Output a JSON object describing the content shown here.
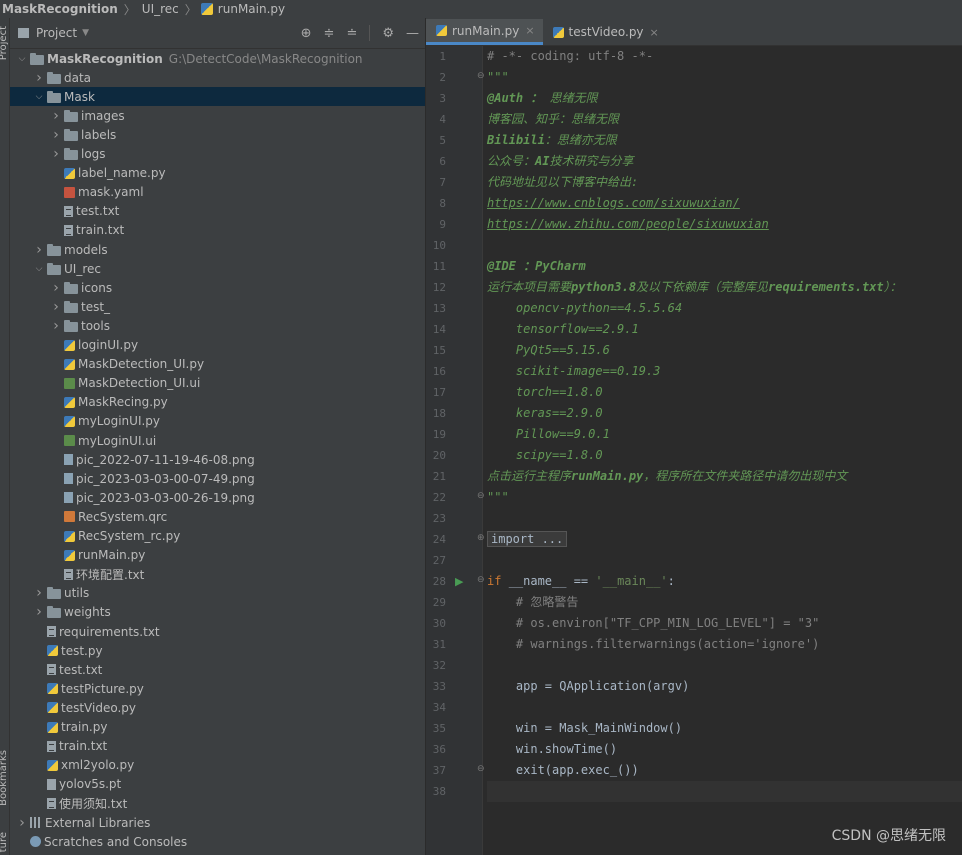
{
  "breadcrumb": {
    "items": [
      "MaskRecognition",
      "UI_rec",
      "runMain.py"
    ]
  },
  "side_labels": {
    "project": "Project",
    "bookmarks": "Bookmarks",
    "structure": "ture"
  },
  "project_panel": {
    "title": "Project",
    "tools": [
      "⊕",
      "≑",
      "≐",
      "⚙",
      "—"
    ]
  },
  "tree": [
    {
      "label": "MaskRecognition",
      "path": "G:\\DetectCode\\MaskRecognition",
      "depth": 0,
      "icon": "folder",
      "expanded": true,
      "bold": true
    },
    {
      "label": "data",
      "depth": 1,
      "icon": "folder",
      "expanded": false
    },
    {
      "label": "Mask",
      "depth": 1,
      "icon": "folder",
      "expanded": true,
      "selected": true
    },
    {
      "label": "images",
      "depth": 2,
      "icon": "folder",
      "expanded": false
    },
    {
      "label": "labels",
      "depth": 2,
      "icon": "folder",
      "expanded": false
    },
    {
      "label": "logs",
      "depth": 2,
      "icon": "folder",
      "expanded": false
    },
    {
      "label": "label_name.py",
      "depth": 2,
      "icon": "py"
    },
    {
      "label": "mask.yaml",
      "depth": 2,
      "icon": "yaml"
    },
    {
      "label": "test.txt",
      "depth": 2,
      "icon": "txt"
    },
    {
      "label": "train.txt",
      "depth": 2,
      "icon": "txt"
    },
    {
      "label": "models",
      "depth": 1,
      "icon": "folder",
      "expanded": false
    },
    {
      "label": "UI_rec",
      "depth": 1,
      "icon": "folder",
      "expanded": true
    },
    {
      "label": "icons",
      "depth": 2,
      "icon": "folder",
      "expanded": false
    },
    {
      "label": "test_",
      "depth": 2,
      "icon": "folder",
      "expanded": false
    },
    {
      "label": "tools",
      "depth": 2,
      "icon": "folder",
      "expanded": false
    },
    {
      "label": "loginUI.py",
      "depth": 2,
      "icon": "py"
    },
    {
      "label": "MaskDetection_UI.py",
      "depth": 2,
      "icon": "py"
    },
    {
      "label": "MaskDetection_UI.ui",
      "depth": 2,
      "icon": "ui"
    },
    {
      "label": "MaskRecing.py",
      "depth": 2,
      "icon": "py"
    },
    {
      "label": "myLoginUI.py",
      "depth": 2,
      "icon": "py"
    },
    {
      "label": "myLoginUI.ui",
      "depth": 2,
      "icon": "ui"
    },
    {
      "label": "pic_2022-07-11-19-46-08.png",
      "depth": 2,
      "icon": "png"
    },
    {
      "label": "pic_2023-03-03-00-07-49.png",
      "depth": 2,
      "icon": "png"
    },
    {
      "label": "pic_2023-03-03-00-26-19.png",
      "depth": 2,
      "icon": "png"
    },
    {
      "label": "RecSystem.qrc",
      "depth": 2,
      "icon": "qrc"
    },
    {
      "label": "RecSystem_rc.py",
      "depth": 2,
      "icon": "py"
    },
    {
      "label": "runMain.py",
      "depth": 2,
      "icon": "py"
    },
    {
      "label": "环境配置.txt",
      "depth": 2,
      "icon": "txt"
    },
    {
      "label": "utils",
      "depth": 1,
      "icon": "folder",
      "expanded": false
    },
    {
      "label": "weights",
      "depth": 1,
      "icon": "folder",
      "expanded": false
    },
    {
      "label": "requirements.txt",
      "depth": 1,
      "icon": "txt"
    },
    {
      "label": "test.py",
      "depth": 1,
      "icon": "py"
    },
    {
      "label": "test.txt",
      "depth": 1,
      "icon": "txt"
    },
    {
      "label": "testPicture.py",
      "depth": 1,
      "icon": "py"
    },
    {
      "label": "testVideo.py",
      "depth": 1,
      "icon": "py"
    },
    {
      "label": "train.py",
      "depth": 1,
      "icon": "py"
    },
    {
      "label": "train.txt",
      "depth": 1,
      "icon": "txt"
    },
    {
      "label": "xml2yolo.py",
      "depth": 1,
      "icon": "py"
    },
    {
      "label": "yolov5s.pt",
      "depth": 1,
      "icon": "pt"
    },
    {
      "label": "使用须知.txt",
      "depth": 1,
      "icon": "txt"
    },
    {
      "label": "External Libraries",
      "depth": 0,
      "icon": "lib",
      "expanded": false
    },
    {
      "label": "Scratches and Consoles",
      "depth": 0,
      "icon": "scratch"
    }
  ],
  "editor_tabs": [
    {
      "label": "runMain.py",
      "active": true,
      "close": "×"
    },
    {
      "label": "testVideo.py",
      "active": false,
      "close": "×"
    }
  ],
  "code_lines": [
    {
      "n": "1",
      "parts": [
        {
          "c": "cmt",
          "t": "# -*- coding: utf-8 -*-"
        }
      ]
    },
    {
      "n": "2",
      "fold": "⊖",
      "parts": [
        {
          "c": "doc",
          "t": "\"\"\""
        }
      ]
    },
    {
      "n": "3",
      "parts": [
        {
          "c": "docb",
          "t": "@Auth ： "
        },
        {
          "c": "doc",
          "t": "思绪无限"
        }
      ]
    },
    {
      "n": "4",
      "parts": [
        {
          "c": "doc",
          "t": "博客园、知乎：思绪无限"
        }
      ]
    },
    {
      "n": "5",
      "parts": [
        {
          "c": "docb",
          "t": "Bilibili"
        },
        {
          "c": "doc",
          "t": "：思绪亦无限"
        }
      ]
    },
    {
      "n": "6",
      "parts": [
        {
          "c": "doc",
          "t": "公众号："
        },
        {
          "c": "docb",
          "t": "AI"
        },
        {
          "c": "doc",
          "t": "技术研究与分享"
        }
      ]
    },
    {
      "n": "7",
      "parts": [
        {
          "c": "doc",
          "t": "代码地址见以下博客中给出:"
        }
      ]
    },
    {
      "n": "8",
      "parts": [
        {
          "c": "link",
          "t": "https://www.cnblogs.com/sixuwuxian/"
        }
      ]
    },
    {
      "n": "9",
      "parts": [
        {
          "c": "link",
          "t": "https://www.zhihu.com/people/sixuwuxian"
        }
      ]
    },
    {
      "n": "10",
      "parts": []
    },
    {
      "n": "11",
      "parts": [
        {
          "c": "docb",
          "t": "@IDE ：PyCharm"
        }
      ]
    },
    {
      "n": "12",
      "parts": [
        {
          "c": "doc",
          "t": "运行本项目需要"
        },
        {
          "c": "docb",
          "t": "python3.8"
        },
        {
          "c": "doc",
          "t": "及以下依赖库（完整库见"
        },
        {
          "c": "docb",
          "t": "requirements.txt"
        },
        {
          "c": "doc",
          "t": "）："
        }
      ]
    },
    {
      "n": "13",
      "parts": [
        {
          "c": "doc",
          "t": "    opencv-python==4.5.5.64"
        }
      ]
    },
    {
      "n": "14",
      "parts": [
        {
          "c": "doc",
          "t": "    tensorflow==2.9.1"
        }
      ]
    },
    {
      "n": "15",
      "parts": [
        {
          "c": "doc",
          "t": "    PyQt5==5.15.6"
        }
      ]
    },
    {
      "n": "16",
      "parts": [
        {
          "c": "doc",
          "t": "    scikit-image==0.19.3"
        }
      ]
    },
    {
      "n": "17",
      "parts": [
        {
          "c": "doc",
          "t": "    torch==1.8.0"
        }
      ]
    },
    {
      "n": "18",
      "parts": [
        {
          "c": "doc",
          "t": "    keras==2.9.0"
        }
      ]
    },
    {
      "n": "19",
      "parts": [
        {
          "c": "doc",
          "t": "    Pillow==9.0.1"
        }
      ]
    },
    {
      "n": "20",
      "parts": [
        {
          "c": "doc",
          "t": "    scipy==1.8.0"
        }
      ]
    },
    {
      "n": "21",
      "parts": [
        {
          "c": "doc",
          "t": "点击运行主程序"
        },
        {
          "c": "docb",
          "t": "runMain.py"
        },
        {
          "c": "doc",
          "t": "，程序所在文件夹路径中请勿出现中文"
        }
      ]
    },
    {
      "n": "22",
      "fold": "⊖",
      "parts": [
        {
          "c": "doc",
          "t": "\"\"\""
        }
      ]
    },
    {
      "n": "23",
      "parts": []
    },
    {
      "n": "24",
      "fold": "⊕",
      "parts": [
        {
          "c": "foldbox",
          "t": "import ..."
        }
      ]
    },
    {
      "n": "27",
      "parts": []
    },
    {
      "n": "28",
      "run": "▶",
      "fold": "⊖",
      "parts": [
        {
          "c": "kw",
          "t": "if "
        },
        {
          "c": "",
          "t": "__name__ == "
        },
        {
          "c": "str",
          "t": "'__main__'"
        },
        {
          "c": "",
          "t": ":"
        }
      ]
    },
    {
      "n": "29",
      "parts": [
        {
          "c": "cmt",
          "t": "    # 忽略警告"
        }
      ]
    },
    {
      "n": "30",
      "parts": [
        {
          "c": "cmt",
          "t": "    # os.environ[\"TF_CPP_MIN_LOG_LEVEL\"] = \"3\""
        }
      ]
    },
    {
      "n": "31",
      "parts": [
        {
          "c": "cmt",
          "t": "    # warnings.filterwarnings(action='ignore')"
        }
      ]
    },
    {
      "n": "32",
      "parts": []
    },
    {
      "n": "33",
      "parts": [
        {
          "c": "",
          "t": "    app = QApplication(argv)"
        }
      ]
    },
    {
      "n": "34",
      "parts": []
    },
    {
      "n": "35",
      "parts": [
        {
          "c": "",
          "t": "    win = Mask_MainWindow()"
        }
      ]
    },
    {
      "n": "36",
      "parts": [
        {
          "c": "",
          "t": "    win.showTime()"
        }
      ]
    },
    {
      "n": "37",
      "fold": "⊖",
      "parts": [
        {
          "c": "",
          "t": "    exit(app.exec_())"
        }
      ]
    },
    {
      "n": "38",
      "current": true,
      "parts": []
    }
  ],
  "watermark": "CSDN @思绪无限"
}
